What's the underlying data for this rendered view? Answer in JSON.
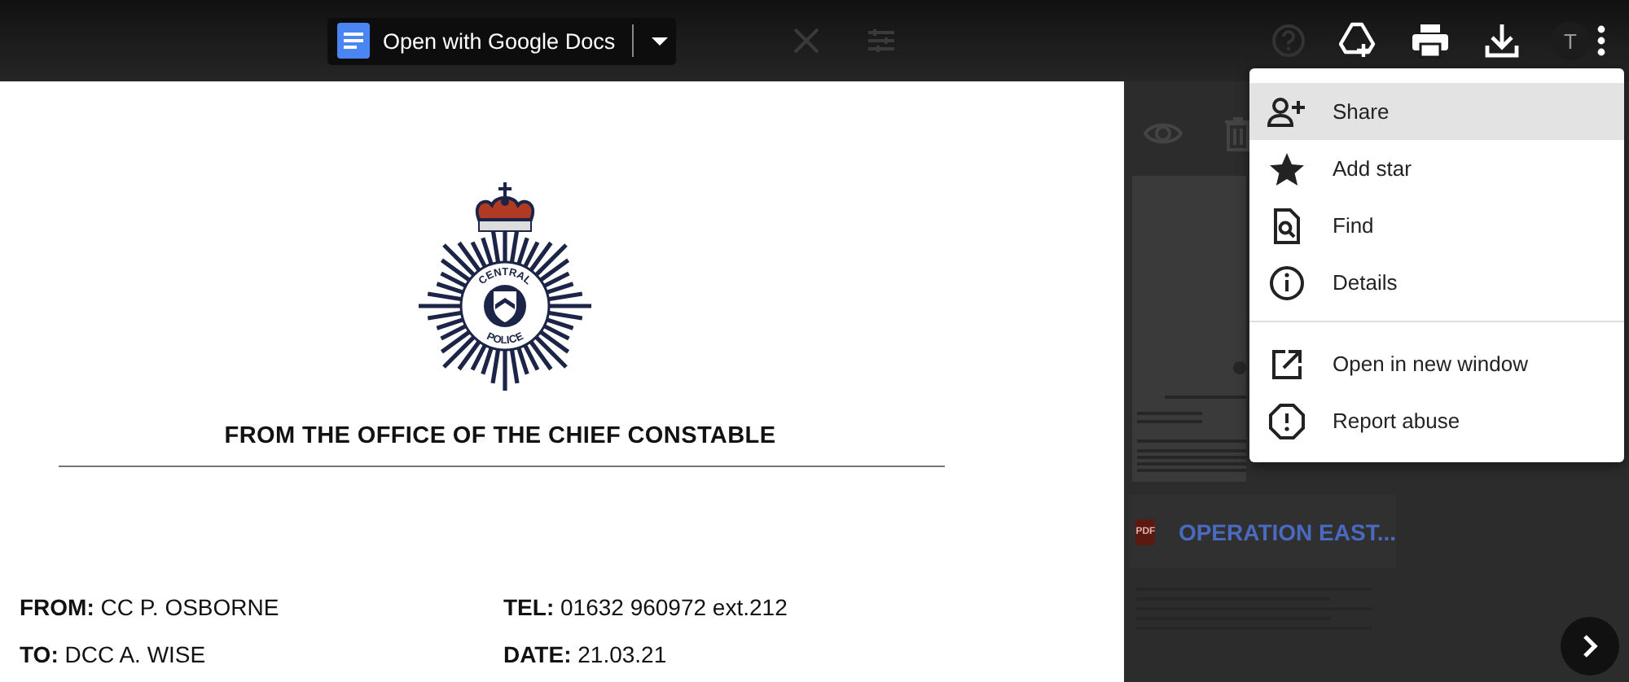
{
  "toolbar": {
    "open_with_button": "Open with Google Docs",
    "avatar": {
      "initial": "T"
    }
  },
  "document": {
    "badge": {
      "ring_top": "CENTRAL",
      "ring_bottom": "POLICE"
    },
    "heading": "FROM THE OFFICE OF THE CHIEF CONSTABLE",
    "fields": [
      {
        "text": "**FROM:** CC P. OSBORNE"
      },
      {
        "text": "**TEL:** 01632 960972 ext.212"
      },
      {
        "text": "**TO:** DCC A. WISE"
      },
      {
        "text": "**DATE:** 21.03.21"
      }
    ]
  },
  "background_panel": {
    "attachment": {
      "file_type": "PDF",
      "title": "OPERATION EAST..."
    }
  },
  "menu": {
    "sections": [
      {
        "items": [
          {
            "kind": "share",
            "label": "Share",
            "selected": true
          },
          {
            "kind": "star",
            "label": "Add star",
            "selected": false
          },
          {
            "kind": "find",
            "label": "Find",
            "selected": false
          },
          {
            "kind": "details",
            "label": "Details",
            "selected": false
          }
        ]
      },
      {
        "items": [
          {
            "kind": "open",
            "label": "Open in new window",
            "selected": false
          },
          {
            "kind": "report",
            "label": "Report abuse",
            "selected": false
          }
        ]
      }
    ]
  }
}
